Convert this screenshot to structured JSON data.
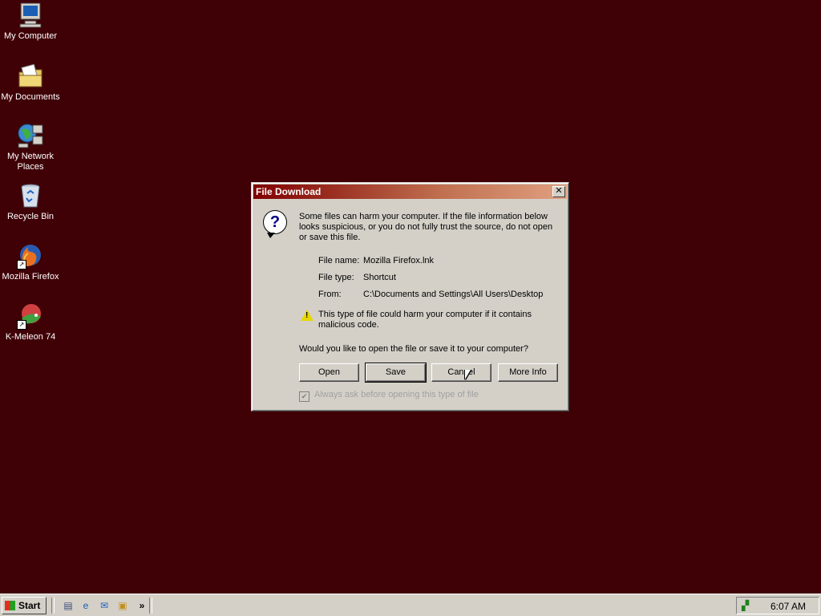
{
  "desktop": {
    "icons": [
      {
        "label": "My Computer",
        "icon": "computer-icon"
      },
      {
        "label": "My Documents",
        "icon": "folder-documents-icon"
      },
      {
        "label": "My Network Places",
        "icon": "network-places-icon"
      },
      {
        "label": "Recycle Bin",
        "icon": "recycle-bin-icon"
      },
      {
        "label": "Mozilla Firefox",
        "icon": "firefox-icon"
      },
      {
        "label": "K-Meleon 74",
        "icon": "kmeleon-icon"
      }
    ]
  },
  "dialog": {
    "title": "File Download",
    "message": "Some files can harm your computer. If the file information below looks suspicious, or you do not fully trust the source, do not open or save this file.",
    "file_name_label": "File name:",
    "file_name": "Mozilla Firefox.lnk",
    "file_type_label": "File type:",
    "file_type": "Shortcut",
    "from_label": "From:",
    "from": "C:\\Documents and Settings\\All Users\\Desktop",
    "warning": "This type of file could harm your computer if it contains malicious code.",
    "question": "Would you like to open the file or save it to your computer?",
    "buttons": {
      "open": "Open",
      "save": "Save",
      "cancel": "Cancel",
      "more_info": "More Info"
    },
    "checkbox_label": "Always ask before opening this type of file",
    "checkbox_checked": true,
    "close_glyph": "✕"
  },
  "taskbar": {
    "start_label": "Start",
    "chevron": "»",
    "clock": "6:07 AM"
  },
  "colors": {
    "desktop_bg": "#3f0006",
    "titlebar_start": "#800000",
    "titlebar_end": "#e0a080",
    "face": "#d4d0c8"
  }
}
